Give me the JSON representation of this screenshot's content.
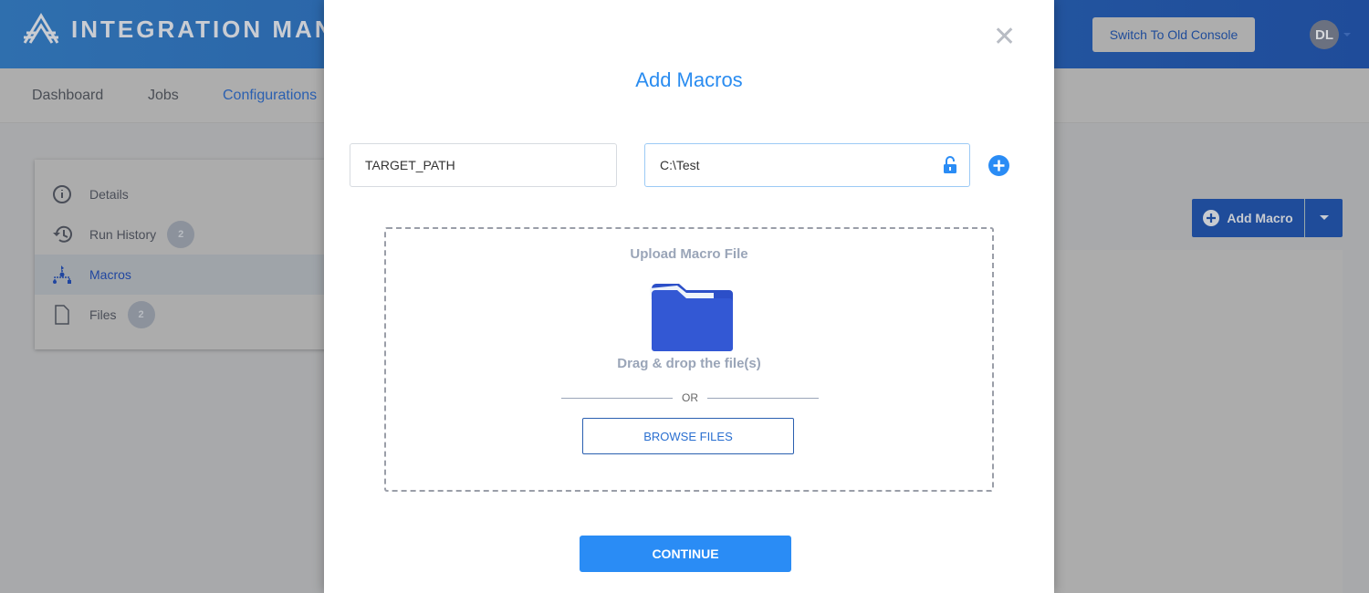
{
  "header": {
    "app_title": "INTEGRATION MANAGER",
    "switch_button": "Switch To Old Console",
    "avatar_initials": "DL"
  },
  "nav": {
    "items": [
      "Dashboard",
      "Jobs",
      "Configurations"
    ],
    "active": "Configurations"
  },
  "sidebar": {
    "items": [
      {
        "label": "Details",
        "icon": "info-icon"
      },
      {
        "label": "Run History",
        "icon": "history-icon",
        "badge": "2"
      },
      {
        "label": "Macros",
        "icon": "flow-icon",
        "active": true
      },
      {
        "label": "Files",
        "icon": "file-icon",
        "badge": "2"
      }
    ]
  },
  "toolbar": {
    "add_macro": "Add Macro"
  },
  "modal": {
    "title": "Add Macros",
    "name_value": "TARGET_PATH",
    "value_value": "C:\\Test",
    "upload_title": "Upload Macro File",
    "drag_text": "Drag & drop the file(s)",
    "or_text": "OR",
    "browse_label": "BROWSE FILES",
    "continue_label": "CONTINUE"
  },
  "colors": {
    "accent": "#2a8cf5",
    "folder": "#3358d4"
  }
}
